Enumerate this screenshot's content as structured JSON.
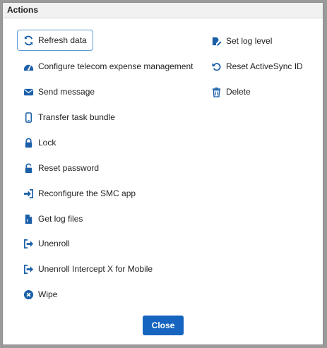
{
  "dialog": {
    "title": "Actions",
    "close_label": "Close"
  },
  "actions_left": [
    {
      "label": "Refresh data",
      "icon": "refresh-icon"
    },
    {
      "label": "Configure telecom expense management",
      "icon": "gauge-icon"
    },
    {
      "label": "Send message",
      "icon": "envelope-icon"
    },
    {
      "label": "Transfer task bundle",
      "icon": "mobile-phone-icon"
    },
    {
      "label": "Lock",
      "icon": "lock-icon"
    },
    {
      "label": "Reset password",
      "icon": "unlock-icon"
    },
    {
      "label": "Reconfigure the SMC app",
      "icon": "sign-in-icon"
    },
    {
      "label": "Get log files",
      "icon": "file-icon"
    },
    {
      "label": "Unenroll",
      "icon": "sign-out-icon"
    },
    {
      "label": "Unenroll Intercept X for Mobile",
      "icon": "sign-out-icon"
    },
    {
      "label": "Wipe",
      "icon": "times-circle-icon"
    }
  ],
  "actions_right": [
    {
      "label": "Set log level",
      "icon": "edit-log-icon"
    },
    {
      "label": "Reset ActiveSync ID",
      "icon": "undo-icon"
    },
    {
      "label": "Delete",
      "icon": "trash-icon"
    }
  ],
  "colors": {
    "icon": "#1a5fa8",
    "primary_button": "#1565c0",
    "focus_ring": "#5b9bd5"
  }
}
